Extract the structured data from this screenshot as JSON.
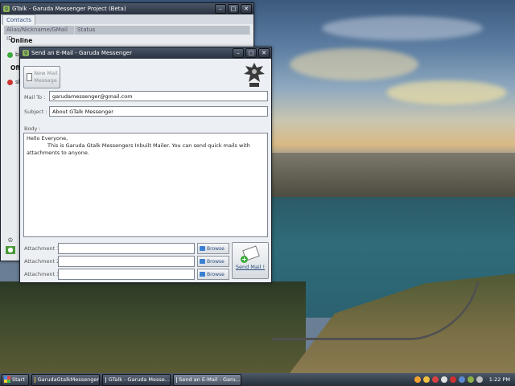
{
  "gtalk_window": {
    "title": "GTalk - Garuda Messenger Project (Beta)",
    "tab": "Contacts",
    "columns": [
      "Alias/Nickname/GMail ID",
      "Status"
    ],
    "groups": [
      {
        "label": "Online",
        "contacts": [
          {
            "name": "b"
          }
        ]
      },
      {
        "label": "Off",
        "contacts": [
          {
            "name": "sh"
          }
        ]
      }
    ]
  },
  "mail_window": {
    "title": "Send an E-Mail - Garuda Messenger",
    "new_mail_label": "New Mail Message",
    "mail_to_label": "Mail To :",
    "mail_to_value": "garudamessenger@gmail.com",
    "subject_label": "Subject :",
    "subject_value": "About GTalk Messenger",
    "body_label": "Body :",
    "body_line1": "Hello Everyone,",
    "body_line2": "This is Garuda Gtalk Messengers Inbuilt Mailer. You can send quick mails with attachments to anyone.",
    "attachments": [
      {
        "label": "Attachment 1 :",
        "value": "",
        "browse": "Browse"
      },
      {
        "label": "Attachment 2 :",
        "value": "",
        "browse": "Browse"
      },
      {
        "label": "Attachment 3 :",
        "value": "",
        "browse": "Browse"
      }
    ],
    "send_label": "Send Mail !"
  },
  "taskbar": {
    "start": "Start",
    "tasks": [
      {
        "label": "GarudaGtalkMessenger",
        "icon": "folder-icon"
      },
      {
        "label": "GTalk - Garuda Messe...",
        "icon": "app-icon"
      },
      {
        "label": "Send an E-Mail - Garu...",
        "icon": "app-icon"
      }
    ],
    "clock": "1:22 PM"
  },
  "colors": {
    "titlebar": "#2a3240",
    "accent_link": "#2a4a7a",
    "online_dot": "#3aaa3a",
    "offline_dot": "#cc3333"
  }
}
